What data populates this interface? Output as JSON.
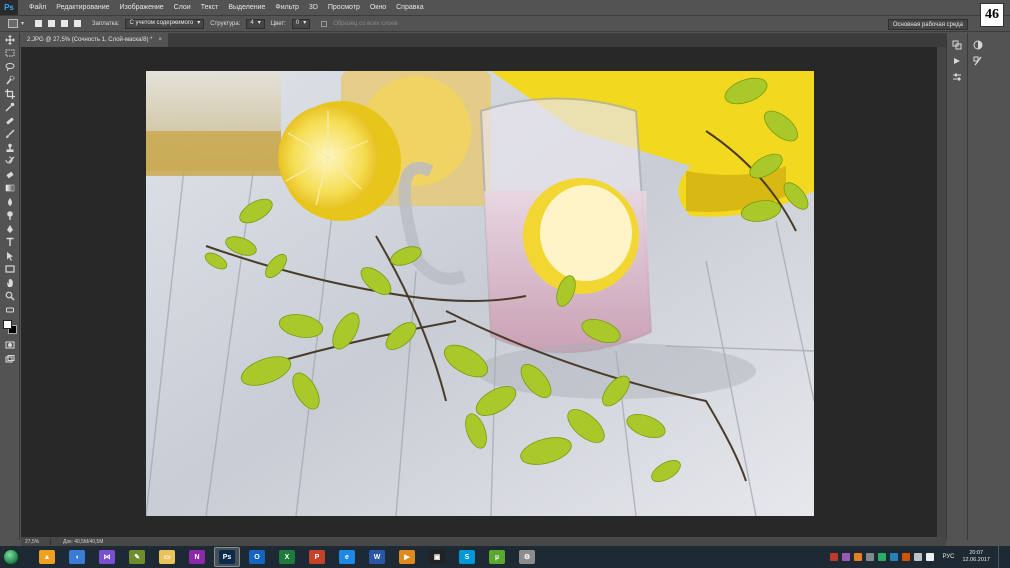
{
  "menubar": {
    "logo": "Ps",
    "items": [
      "Файл",
      "Редактирование",
      "Изображение",
      "Слои",
      "Текст",
      "Выделение",
      "Фильтр",
      "3D",
      "Просмотр",
      "Окно",
      "Справка"
    ]
  },
  "options": {
    "fill_label": "Заплатка:",
    "fill_value": "С учетом содержимого",
    "structure_label": "Структура:",
    "structure_value": "4",
    "color_label": "Цвет:",
    "color_value": "0",
    "sample_all_label": "Образец со всех слоев",
    "workspace": "Основная рабочая среда"
  },
  "badge": "46",
  "document": {
    "tab_title": "2.JPG @ 27,5% (Сочность 1, Слой-маска/8) *",
    "close": "×"
  },
  "status": {
    "zoom": "27,5%",
    "doc_size": "Док: 40,5M/40,5M"
  },
  "toolbar_icons": [
    "move-icon",
    "marquee-icon",
    "lasso-icon",
    "quick-select-icon",
    "crop-icon",
    "eyedropper-icon",
    "healing-brush-icon",
    "brush-icon",
    "clone-stamp-icon",
    "history-brush-icon",
    "eraser-icon",
    "gradient-icon",
    "blur-icon",
    "dodge-icon",
    "pen-icon",
    "type-icon",
    "path-select-icon",
    "rectangle-icon",
    "hand-icon",
    "zoom-icon",
    "edit-toolbar-icon"
  ],
  "taskbar": {
    "apps": [
      {
        "name": "aimp",
        "glyph": "▲",
        "bg": "#f0a020"
      },
      {
        "name": "speaker",
        "glyph": "◖",
        "bg": "#3a7bd5"
      },
      {
        "name": "visual-studio",
        "glyph": "⋈",
        "bg": "#7a4fd0"
      },
      {
        "name": "notepad",
        "glyph": "✎",
        "bg": "#6e8c2e"
      },
      {
        "name": "file-explorer",
        "glyph": "▭",
        "bg": "#e8c25a"
      },
      {
        "name": "onenote",
        "glyph": "N",
        "bg": "#8a2aa8"
      },
      {
        "name": "photoshop",
        "glyph": "Ps",
        "bg": "#0c2a4a"
      },
      {
        "name": "outlook",
        "glyph": "O",
        "bg": "#1565c0"
      },
      {
        "name": "excel",
        "glyph": "X",
        "bg": "#1e7b3c"
      },
      {
        "name": "powerpoint",
        "glyph": "P",
        "bg": "#c5422a"
      },
      {
        "name": "internet-explorer",
        "glyph": "e",
        "bg": "#1e88e5"
      },
      {
        "name": "word",
        "glyph": "W",
        "bg": "#2a56a8"
      },
      {
        "name": "media-player",
        "glyph": "▶",
        "bg": "#e08a1e"
      },
      {
        "name": "terminal",
        "glyph": "▣",
        "bg": "#222222"
      },
      {
        "name": "skype",
        "glyph": "S",
        "bg": "#0097d8"
      },
      {
        "name": "utorrent",
        "glyph": "µ",
        "bg": "#5aa830"
      },
      {
        "name": "tool",
        "glyph": "⚙",
        "bg": "#8c8c8c"
      }
    ],
    "active_app": "photoshop",
    "lang": "РУС",
    "time": "20:07",
    "date": "12.06.2017"
  }
}
